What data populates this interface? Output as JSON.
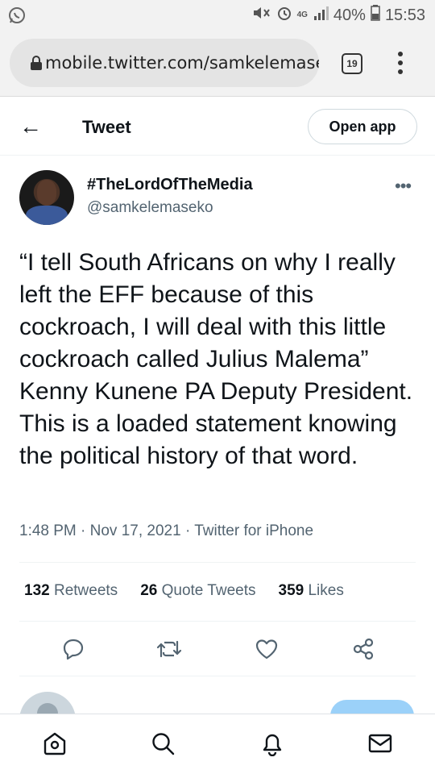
{
  "statusbar": {
    "network": "4G",
    "battery": "40%",
    "time": "15:53"
  },
  "browser": {
    "url": "mobile.twitter.com/samkelemaseko",
    "tab_count": "19"
  },
  "header": {
    "back": "←",
    "title": "Tweet",
    "open_app": "Open app"
  },
  "tweet": {
    "display_name": "#TheLordOfTheMedia",
    "handle": "@samkelemaseko",
    "more": "•••",
    "text": "“I tell South Africans on why I really left the EFF because of this cockroach, I will deal with this little cockroach called Julius Malema” Kenny Kunene PA Deputy President. This is a loaded statement knowing the political history of that word.",
    "meta": "1:48 PM · Nov 17, 2021 · Twitter for iPhone"
  },
  "stats": [
    {
      "count": "132",
      "label": "Retweets"
    },
    {
      "count": "26",
      "label": "Quote Tweets"
    },
    {
      "count": "359",
      "label": "Likes"
    }
  ],
  "colors": {
    "text_primary": "#0f1419",
    "text_secondary": "#536471",
    "accent": "#1d9bf0",
    "reply_button": "#9bd1f9"
  },
  "icons": {
    "actions": [
      "reply-icon",
      "retweet-icon",
      "like-icon",
      "share-icon"
    ],
    "nav": [
      "home-icon",
      "search-icon",
      "notifications-icon",
      "messages-icon"
    ]
  }
}
